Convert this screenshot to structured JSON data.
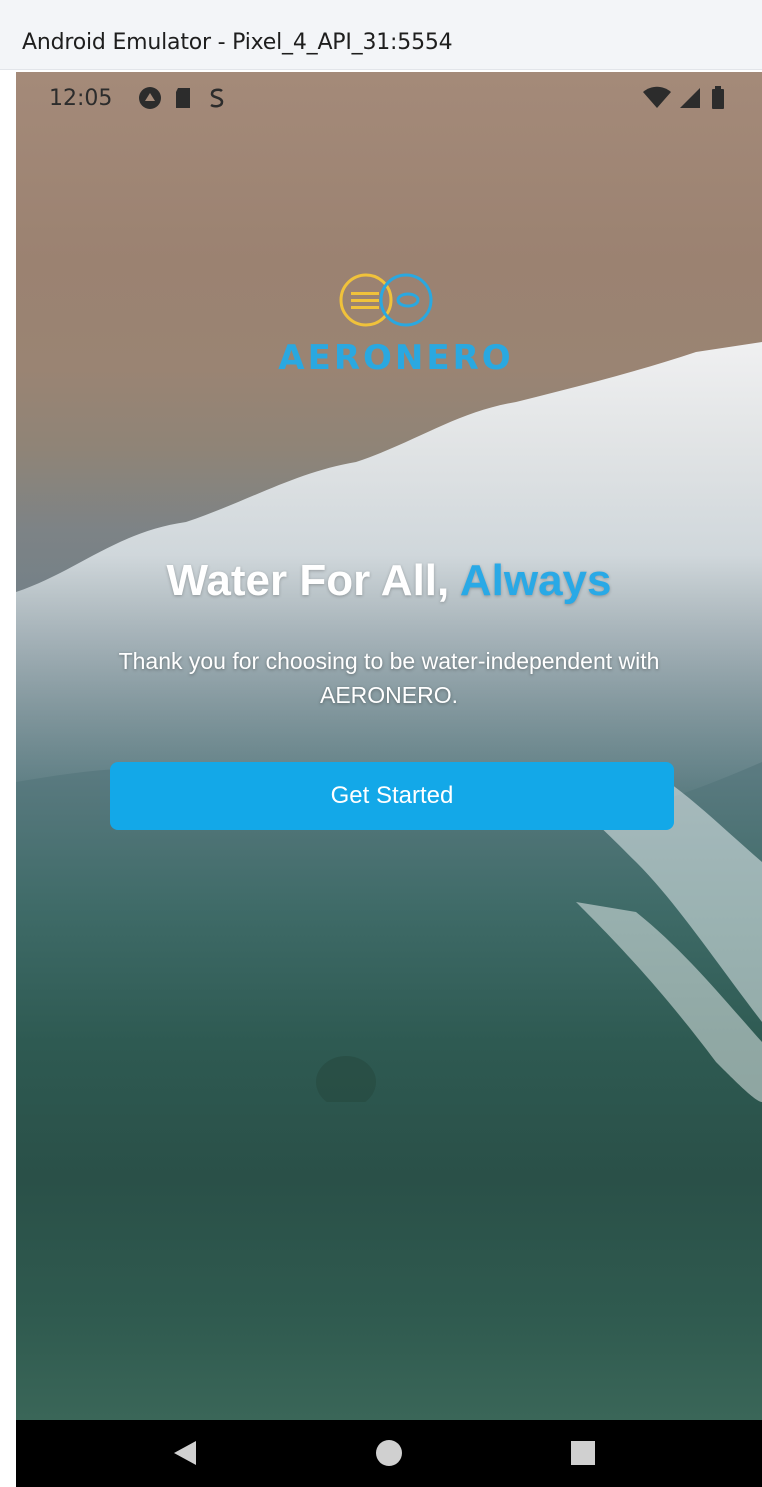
{
  "window": {
    "title": "Android Emulator - Pixel_4_API_31:5554"
  },
  "statusbar": {
    "time": "12:05",
    "left_icons": [
      "drive-icon",
      "sd-card-icon",
      "s-notification-icon"
    ],
    "right_icons": [
      "wifi-icon",
      "signal-icon",
      "battery-icon"
    ]
  },
  "logo": {
    "wordmark": "AERONERO",
    "tagline": "",
    "color": "#2aa8e0",
    "accent_color": "#f0c23b"
  },
  "hero": {
    "headline_main": "Water For All, ",
    "headline_accent": "Always",
    "accent_color": "#29a9e6",
    "subtext": "Thank you for choosing to be water-independent with AERONERO."
  },
  "cta": {
    "label": "Get Started",
    "color": "#13a8e8"
  },
  "navbar": {
    "buttons": [
      "back-icon",
      "home-icon",
      "recents-icon"
    ]
  }
}
